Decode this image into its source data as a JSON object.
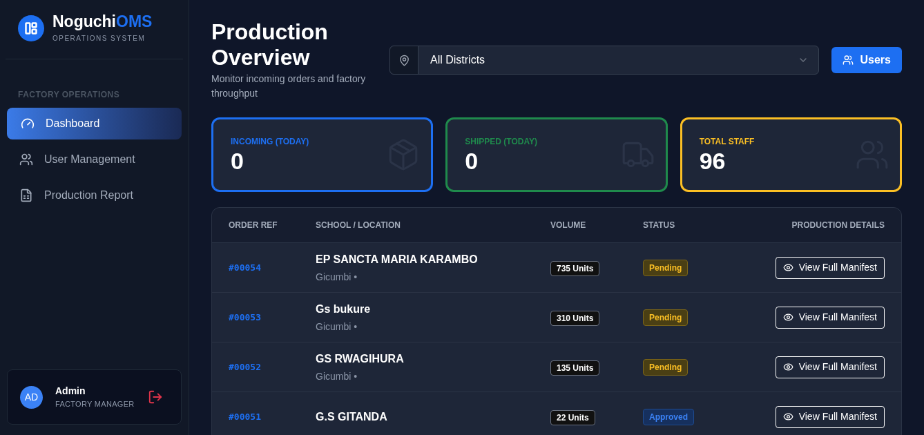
{
  "brand": {
    "name": "Noguchi",
    "accent": "OMS",
    "subtitle": "OPERATIONS SYSTEM"
  },
  "sidebar": {
    "section": "FACTORY OPERATIONS",
    "items": [
      {
        "label": "Dashboard",
        "selected": true
      },
      {
        "label": "User Management",
        "selected": false
      },
      {
        "label": "Production Report",
        "selected": false
      }
    ]
  },
  "user": {
    "initials": "AD",
    "name": "Admin",
    "role": "FACTORY MANAGER"
  },
  "header": {
    "title": "Production Overview",
    "subtitle": "Monitor incoming orders and factory throughput",
    "district": "All Districts",
    "users_button": "Users"
  },
  "stats": [
    {
      "label": "INCOMING (TODAY)",
      "value": "0",
      "color": "#1d6ff2"
    },
    {
      "label": "SHIPPED (TODAY)",
      "value": "0",
      "color": "#1f8a4c"
    },
    {
      "label": "TOTAL STAFF",
      "value": "96",
      "color": "#fbbf24"
    }
  ],
  "table": {
    "columns": [
      "ORDER REF",
      "SCHOOL / LOCATION",
      "VOLUME",
      "STATUS",
      "PRODUCTION DETAILS"
    ],
    "rows": [
      {
        "ref": "#00054",
        "school": "EP SANCTA MARIA KARAMBO",
        "location": "Gicumbi •",
        "volume": "735 Units",
        "status": "Pending",
        "kind": "pending",
        "action": "View Full Manifest"
      },
      {
        "ref": "#00053",
        "school": "Gs bukure",
        "location": "Gicumbi •",
        "volume": "310 Units",
        "status": "Pending",
        "kind": "pending",
        "action": "View Full Manifest"
      },
      {
        "ref": "#00052",
        "school": "GS RWAGIHURA",
        "location": "Gicumbi •",
        "volume": "135 Units",
        "status": "Pending",
        "kind": "pending",
        "action": "View Full Manifest"
      },
      {
        "ref": "#00051",
        "school": "G.S GITANDA",
        "volume": "22 Units",
        "status": "Approved",
        "kind": "approved",
        "action": "View Full Manifest"
      }
    ]
  }
}
